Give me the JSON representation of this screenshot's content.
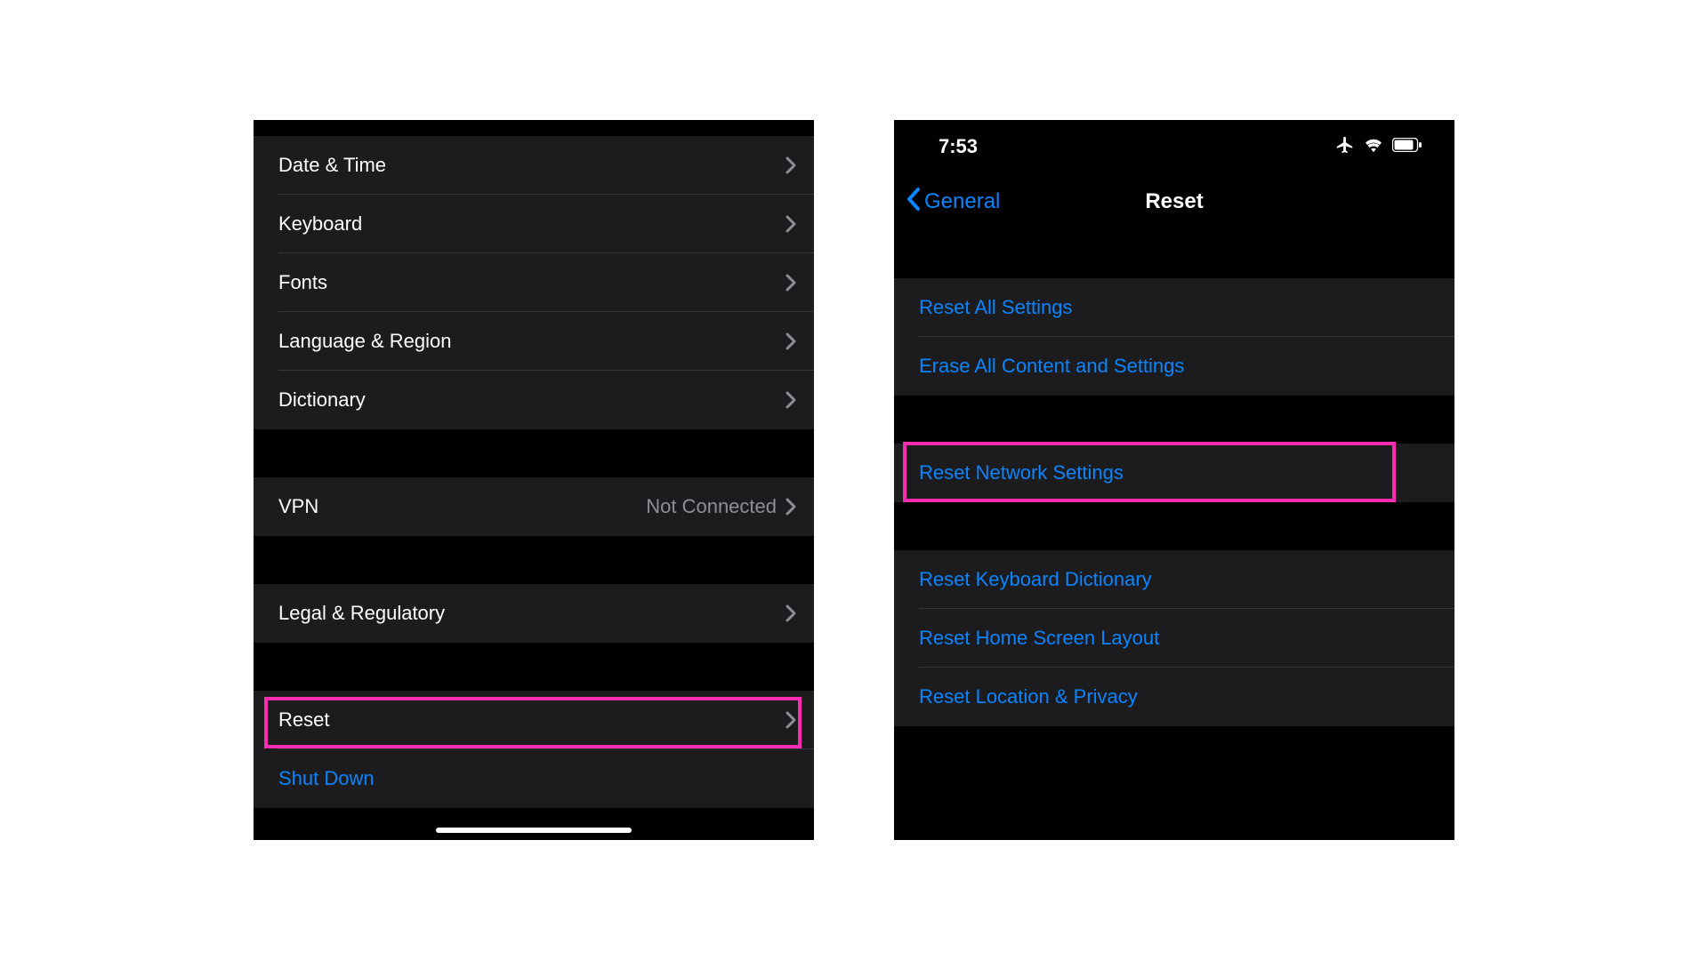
{
  "left": {
    "groups": {
      "g1": [
        {
          "label": "Date & Time"
        },
        {
          "label": "Keyboard"
        },
        {
          "label": "Fonts"
        },
        {
          "label": "Language & Region"
        },
        {
          "label": "Dictionary"
        }
      ],
      "vpn": {
        "label": "VPN",
        "value": "Not Connected"
      },
      "legal": {
        "label": "Legal & Regulatory"
      },
      "reset": {
        "label": "Reset"
      },
      "shutdown": {
        "label": "Shut Down"
      }
    }
  },
  "right": {
    "status": {
      "time": "7:53"
    },
    "nav": {
      "back": "General",
      "title": "Reset"
    },
    "actions": {
      "g1": [
        {
          "label": "Reset All Settings"
        },
        {
          "label": "Erase All Content and Settings"
        }
      ],
      "g2": [
        {
          "label": "Reset Network Settings"
        }
      ],
      "g3": [
        {
          "label": "Reset Keyboard Dictionary"
        },
        {
          "label": "Reset Home Screen Layout"
        },
        {
          "label": "Reset Location & Privacy"
        }
      ]
    }
  },
  "colors": {
    "accent": "#0a84ff",
    "highlight": "#ff2bb1"
  }
}
